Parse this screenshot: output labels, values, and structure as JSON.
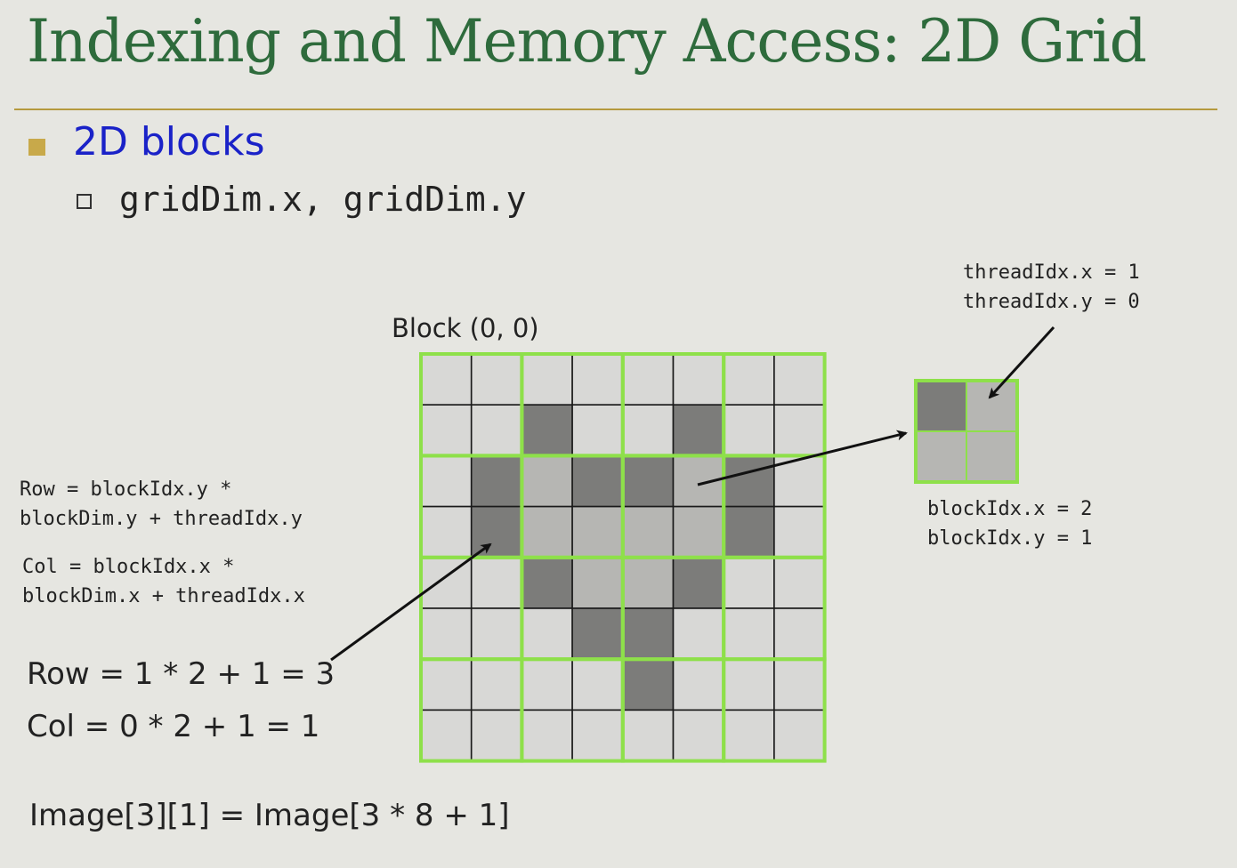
{
  "slide": {
    "title": "Indexing and Memory Access: 2D Grid",
    "bullet": "2D blocks",
    "sub_bullet": "gridDim.x, gridDim.y"
  },
  "diagram": {
    "block_label": "Block (0, 0)",
    "thread_idx_x": "threadIdx.x = 1",
    "thread_idx_y": "threadIdx.y = 0",
    "block_idx_x": "blockIdx.x = 2",
    "block_idx_y": "blockIdx.y = 1",
    "row_formula_1": "Row = blockIdx.y *",
    "row_formula_2": "blockDim.y + threadIdx.y",
    "col_formula_1": "Col = blockIdx.x *",
    "col_formula_2": "blockDim.x + threadIdx.x",
    "row_example": "Row = 1 * 2 + 1 = 3",
    "col_example": "Col = 0 * 2 + 1 = 1",
    "image_example": "Image[3][1] = Image[3 * 8 + 1]",
    "grid_rows": 8,
    "grid_cols": 8,
    "block_size": 2,
    "dark_cells": [
      [
        1,
        2
      ],
      [
        1,
        5
      ],
      [
        2,
        1
      ],
      [
        2,
        3
      ],
      [
        2,
        4
      ],
      [
        2,
        6
      ],
      [
        3,
        1
      ],
      [
        3,
        6
      ],
      [
        4,
        2
      ],
      [
        4,
        5
      ],
      [
        5,
        3
      ],
      [
        5,
        4
      ],
      [
        6,
        4
      ]
    ],
    "medium_cells": [
      [
        2,
        2
      ],
      [
        2,
        5
      ],
      [
        3,
        2
      ],
      [
        3,
        3
      ],
      [
        3,
        4
      ],
      [
        3,
        5
      ],
      [
        4,
        3
      ],
      [
        4,
        4
      ]
    ],
    "zoom_dark_cells": [
      [
        0,
        0
      ]
    ],
    "colors": {
      "background": "#e6e6e1",
      "title": "#2e6b3c",
      "bullet_text": "#1a22c8",
      "rule": "#b59a3e",
      "block_border": "#8ee04a",
      "cell_light": "#d8d8d6",
      "cell_medium": "#b6b6b3",
      "cell_dark": "#7c7c7a"
    }
  }
}
